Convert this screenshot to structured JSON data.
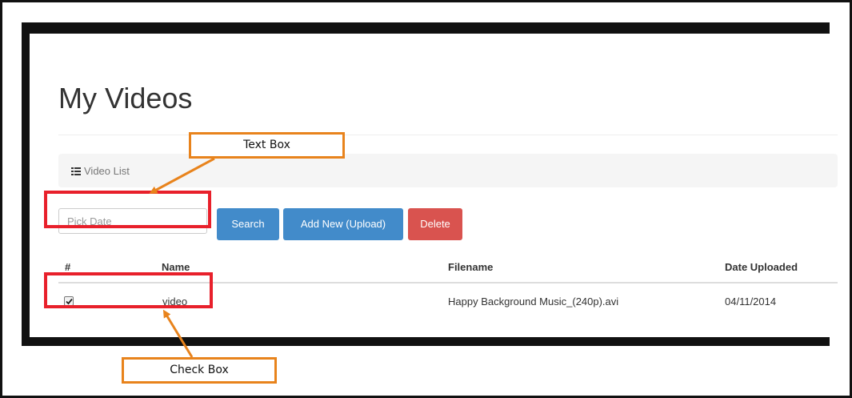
{
  "app": {
    "page_title": "My Videos",
    "breadcrumb": {
      "icon": "list-icon",
      "label": "Video List"
    },
    "toolbar": {
      "date_placeholder": "Pick Date",
      "date_value": "",
      "search_label": "Search",
      "add_label": "Add New (Upload)",
      "delete_label": "Delete"
    },
    "table": {
      "headers": [
        "#",
        "Name",
        "Filename",
        "Date Uploaded"
      ],
      "rows": [
        {
          "checked": true,
          "name": "video",
          "filename": "Happy Background Music_(240p).avi",
          "date": "04/11/2014"
        }
      ]
    }
  },
  "annotations": {
    "text_box_label": "Text Box",
    "check_box_label": "Check Box"
  },
  "colors": {
    "primary": "#428bca",
    "danger": "#d9534f",
    "highlight": "#e8202b",
    "callout_border": "#e8831c"
  }
}
